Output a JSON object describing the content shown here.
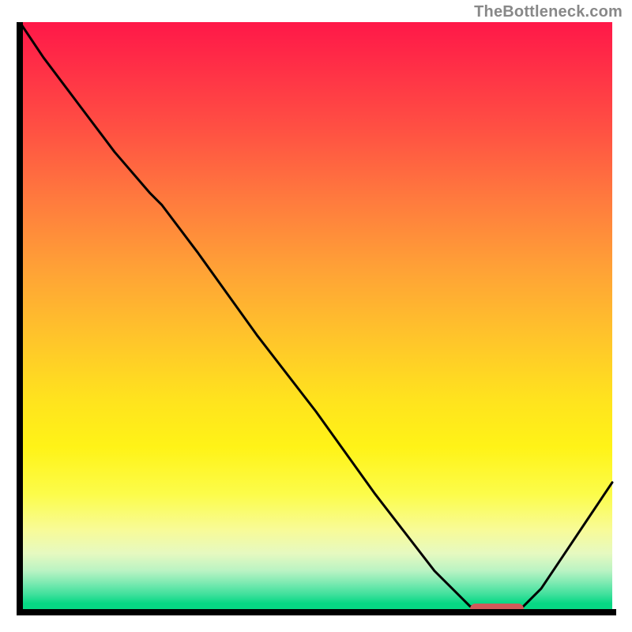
{
  "attribution": "TheBottleneck.com",
  "chart_data": {
    "type": "line",
    "title": "",
    "xlabel": "",
    "ylabel": "",
    "xlim": [
      0,
      100
    ],
    "ylim": [
      0,
      100
    ],
    "series": [
      {
        "name": "curve",
        "x": [
          0,
          4,
          10,
          16,
          22,
          24,
          30,
          40,
          50,
          60,
          70,
          76,
          80,
          84,
          88,
          92,
          96,
          100
        ],
        "values": [
          100,
          94,
          86,
          78,
          71,
          69,
          61,
          47,
          34,
          20,
          7,
          1,
          0,
          0,
          4,
          10,
          16,
          22
        ]
      }
    ],
    "marker": {
      "x_start": 76,
      "x_end": 85,
      "y": 0
    },
    "background_gradient": {
      "stops": [
        {
          "pos": 0,
          "color": "#ff1848"
        },
        {
          "pos": 0.5,
          "color": "#ffc62a"
        },
        {
          "pos": 0.8,
          "color": "#fcfc4a"
        },
        {
          "pos": 1.0,
          "color": "#07d884"
        }
      ]
    }
  }
}
